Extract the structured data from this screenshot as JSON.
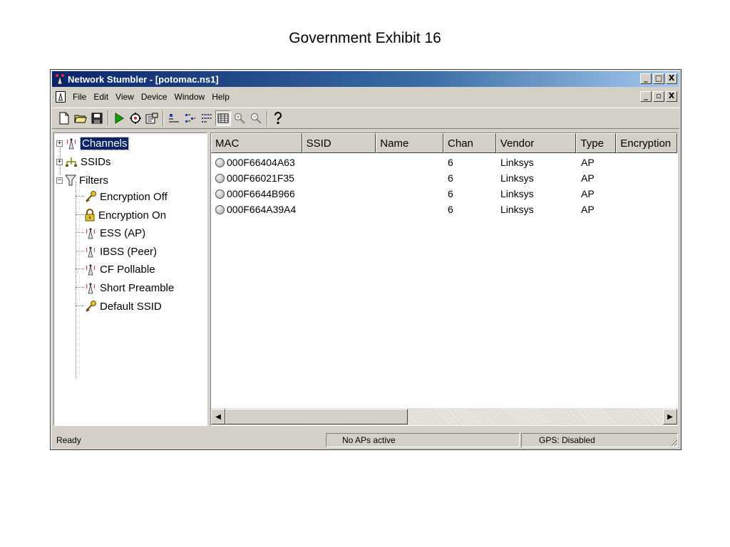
{
  "exhibit_title": "Government Exhibit 16",
  "window": {
    "title": "Network Stumbler - [potomac.ns1]",
    "buttons": {
      "minimize": "_",
      "maximize": "□",
      "close": "X",
      "restore": "▫"
    }
  },
  "menu": [
    "File",
    "Edit",
    "View",
    "Device",
    "Window",
    "Help"
  ],
  "toolbar": [
    "new-doc-icon",
    "open-folder-icon",
    "save-icon",
    "play-icon",
    "auto-config-icon",
    "properties-icon",
    "large-icons-icon",
    "small-icons-icon",
    "list-view-icon",
    "details-view-icon",
    "zoom-in-icon",
    "zoom-out-icon",
    "help-icon"
  ],
  "tree": {
    "channels": "Channels",
    "ssids": "SSIDs",
    "filters": "Filters",
    "filter_items": [
      "Encryption Off",
      "Encryption On",
      "ESS (AP)",
      "IBSS (Peer)",
      "CF Pollable",
      "Short Preamble",
      "Default SSID"
    ],
    "expand_collapsed": "+",
    "expand_open": "−"
  },
  "list": {
    "columns": [
      "MAC",
      "SSID",
      "Name",
      "Chan",
      "Vendor",
      "Type",
      "Encryption"
    ],
    "rows": [
      {
        "mac": "000F66404A63",
        "ssid": "",
        "name": "",
        "chan": "6",
        "vendor": "Linksys",
        "type": "AP",
        "encryption": ""
      },
      {
        "mac": "000F66021F35",
        "ssid": "",
        "name": "",
        "chan": "6",
        "vendor": "Linksys",
        "type": "AP",
        "encryption": ""
      },
      {
        "mac": "000F6644B966",
        "ssid": "",
        "name": "",
        "chan": "6",
        "vendor": "Linksys",
        "type": "AP",
        "encryption": ""
      },
      {
        "mac": "000F664A39A4",
        "ssid": "",
        "name": "",
        "chan": "6",
        "vendor": "Linksys",
        "type": "AP",
        "encryption": ""
      }
    ]
  },
  "scrollbar": {
    "left": "◀",
    "right": "▶"
  },
  "status": {
    "ready": "Ready",
    "aps": "No APs active",
    "gps": "GPS: Disabled"
  },
  "colors": {
    "titlebar_start": "#0a246a",
    "titlebar_end": "#a6caf0",
    "chrome": "#d4d0c8"
  }
}
